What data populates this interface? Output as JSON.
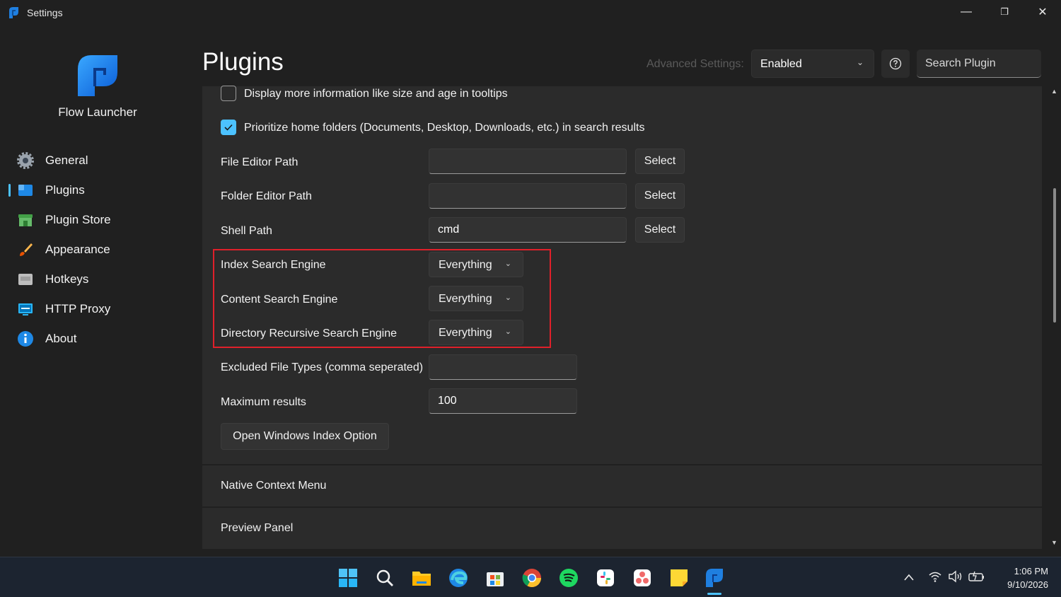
{
  "window": {
    "title": "Settings",
    "controls": {
      "minimize": "—",
      "maximize": "❐",
      "close": "✕"
    }
  },
  "sidebar": {
    "brand_name": "Flow Launcher",
    "items": [
      {
        "label": "General",
        "icon": "gear-icon"
      },
      {
        "label": "Plugins",
        "icon": "plugins-icon",
        "active": true
      },
      {
        "label": "Plugin Store",
        "icon": "store-icon"
      },
      {
        "label": "Appearance",
        "icon": "brush-icon"
      },
      {
        "label": "Hotkeys",
        "icon": "keyboard-icon"
      },
      {
        "label": "HTTP Proxy",
        "icon": "proxy-icon"
      },
      {
        "label": "About",
        "icon": "info-icon"
      }
    ]
  },
  "header": {
    "title": "Plugins",
    "advanced_label": "Advanced Settings:",
    "advanced_value": "Enabled",
    "search_placeholder": "Search Plugin"
  },
  "settings": {
    "check_tooltips": {
      "label": "Display more information like size and age in tooltips",
      "checked": false
    },
    "check_home": {
      "label": "Prioritize home folders (Documents, Desktop, Downloads, etc.) in search results",
      "checked": true
    },
    "file_editor": {
      "label": "File Editor Path",
      "value": "",
      "button": "Select"
    },
    "folder_editor": {
      "label": "Folder Editor Path",
      "value": "",
      "button": "Select"
    },
    "shell_path": {
      "label": "Shell Path",
      "value": "cmd",
      "button": "Select"
    },
    "index_engine": {
      "label": "Index Search Engine",
      "value": "Everything"
    },
    "content_engine": {
      "label": "Content Search Engine",
      "value": "Everything"
    },
    "dir_engine": {
      "label": "Directory Recursive Search Engine",
      "value": "Everything"
    },
    "excluded_types": {
      "label": "Excluded File Types (comma seperated)",
      "value": ""
    },
    "max_results": {
      "label": "Maximum results",
      "value": "100"
    },
    "open_index_button": "Open Windows Index Option"
  },
  "sections": {
    "native_context": "Native Context Menu",
    "preview_panel": "Preview Panel"
  },
  "taskbar": {
    "apps": [
      "start-icon",
      "search-icon",
      "file-explorer-icon",
      "edge-icon",
      "store-icon",
      "chrome-icon",
      "spotify-icon",
      "slack-icon",
      "asana-icon",
      "sticky-notes-icon",
      "flow-launcher-icon"
    ],
    "time": "1:06 PM",
    "date": "9/10/2026"
  },
  "colors": {
    "accent": "#4cc2ff",
    "highlight_border": "#e0202a",
    "background": "#202020",
    "panel": "#2b2b2b"
  }
}
